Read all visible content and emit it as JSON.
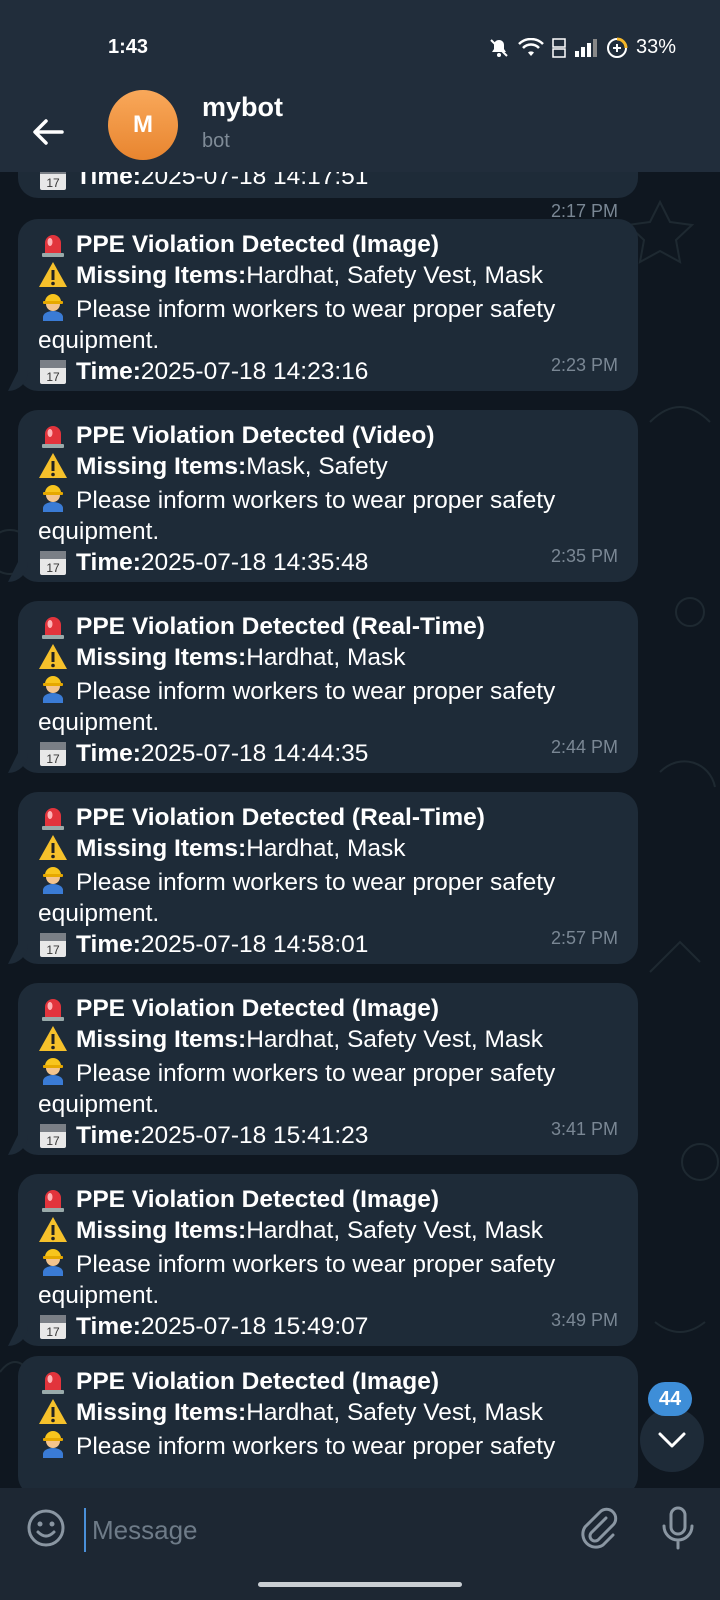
{
  "status_bar": {
    "time": "1:43",
    "battery": "33%"
  },
  "header": {
    "avatar_letter": "M",
    "title": "mybot",
    "subtitle": "bot",
    "side_button": "•••"
  },
  "partial_message": {
    "time_label": "Time:",
    "time_value": " 2025-07-18 14:17:51",
    "timestamp": "2:17 PM"
  },
  "messages": [
    {
      "title": "PPE Violation Detected (Image)",
      "missing_label": "Missing Items:",
      "missing_value": " Hardhat, Safety Vest, Mask",
      "notice": "Please inform workers to wear proper safety equipment.",
      "time_label": "Time:",
      "time_value": " 2025-07-18 14:23:16",
      "timestamp": "2:23 PM"
    },
    {
      "title": "PPE Violation Detected (Video)",
      "missing_label": "Missing Items:",
      "missing_value": " Mask, Safety",
      "notice": "Please inform workers to wear proper safety equipment.",
      "time_label": "Time:",
      "time_value": " 2025-07-18 14:35:48",
      "timestamp": "2:35 PM"
    },
    {
      "title": "PPE Violation Detected (Real-Time)",
      "missing_label": "Missing Items:",
      "missing_value": " Hardhat, Mask",
      "notice": "Please inform workers to wear proper safety equipment.",
      "time_label": "Time:",
      "time_value": " 2025-07-18 14:44:35",
      "timestamp": "2:44 PM"
    },
    {
      "title": "PPE Violation Detected (Real-Time)",
      "missing_label": "Missing Items:",
      "missing_value": " Hardhat, Mask",
      "notice": "Please inform workers to wear proper safety equipment.",
      "time_label": "Time:",
      "time_value": " 2025-07-18 14:58:01",
      "timestamp": "2:57 PM"
    },
    {
      "title": "PPE Violation Detected (Image)",
      "missing_label": "Missing Items:",
      "missing_value": " Hardhat, Safety Vest, Mask",
      "notice": "Please inform workers to wear proper safety equipment.",
      "time_label": "Time:",
      "time_value": " 2025-07-18 15:41:23",
      "timestamp": "3:41 PM"
    },
    {
      "title": "PPE Violation Detected (Image)",
      "missing_label": "Missing Items:",
      "missing_value": " Hardhat, Safety Vest, Mask",
      "notice": "Please inform workers to wear proper safety equipment.",
      "time_label": "Time:",
      "time_value": " 2025-07-18 15:49:07",
      "timestamp": "3:49 PM"
    },
    {
      "title": "PPE Violation Detected (Image)",
      "missing_label": "Missing Items:",
      "missing_value": " Hardhat, Safety Vest, Mask",
      "notice": "Please inform workers to wear proper safety",
      "time_label": "",
      "time_value": "",
      "timestamp": ""
    }
  ],
  "scroll": {
    "unread_count": "44"
  },
  "composer": {
    "placeholder": "Message"
  },
  "icons": {
    "siren": "siren-icon",
    "warning": "warning-icon",
    "worker": "construction-worker-icon",
    "calendar": "calendar-icon",
    "back": "back-arrow-icon",
    "emoji": "emoji-icon",
    "attach": "paperclip-icon",
    "mic": "microphone-icon"
  },
  "colors": {
    "bubble": "#1e2b38",
    "header": "#212d3b",
    "background": "#0f1720",
    "accent": "#3e8ed8",
    "avatar": "#f39a48"
  }
}
